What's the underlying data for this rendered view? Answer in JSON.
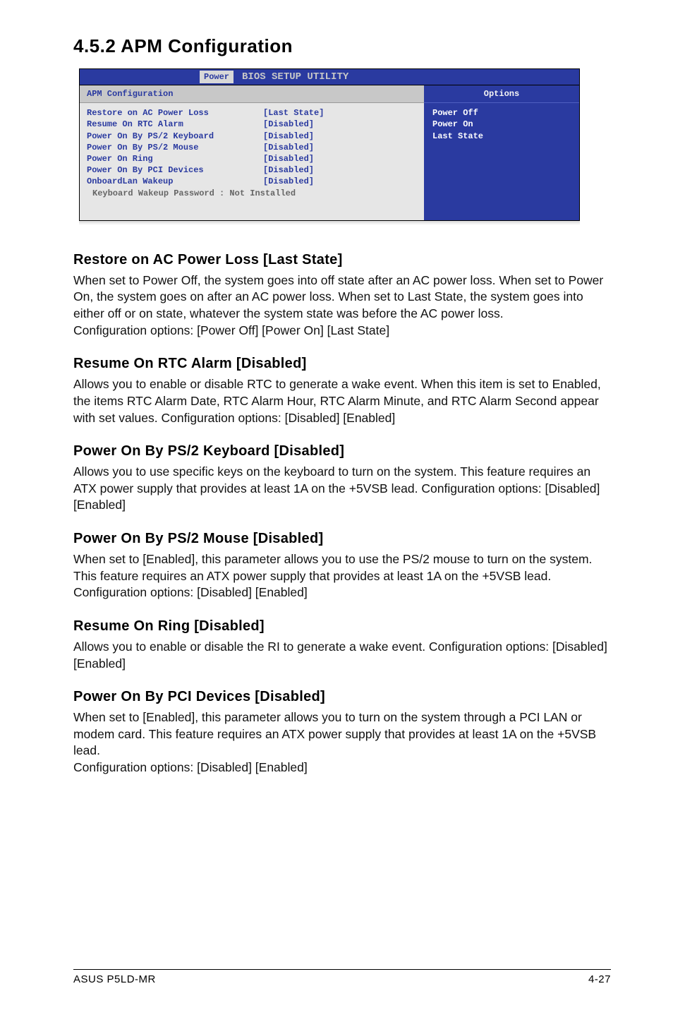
{
  "heading": "4.5.2   APM Configuration",
  "bios": {
    "util_title": "BIOS SETUP UTILITY",
    "tab": "Power",
    "section_head": "APM Configuration",
    "items": [
      {
        "label": "Restore on AC Power Loss",
        "value": "[Last State]"
      },
      {
        "label": "Resume On RTC Alarm",
        "value": "[Disabled]"
      },
      {
        "label": "Power On By PS/2 Keyboard",
        "value": "[Disabled]"
      },
      {
        "label": "Power On By PS/2 Mouse",
        "value": "[Disabled]"
      },
      {
        "label": "Power On Ring",
        "value": "[Disabled]"
      },
      {
        "label": "Power On By PCI Devices",
        "value": "[Disabled]"
      },
      {
        "label": "OnboardLan Wakeup",
        "value": "[Disabled]"
      }
    ],
    "subline": "Keyboard Wakeup Password : Not Installed",
    "options_head": "Options",
    "options": [
      "Power Off",
      "Power On",
      "Last State"
    ]
  },
  "sections": [
    {
      "title": "Restore on AC Power Loss [Last State]",
      "body": "When set to Power Off, the system goes into off state after an AC power loss. When set to Power On, the system goes on after an AC power loss. When set to Last State, the system goes into either off or on state, whatever the system state was before the AC power loss.\nConfiguration options: [Power Off] [Power On] [Last State]"
    },
    {
      "title": "Resume On RTC Alarm [Disabled]",
      "body": "Allows you to enable or disable RTC to generate a wake event. When this item is set to Enabled, the items RTC Alarm Date, RTC Alarm Hour, RTC Alarm Minute, and RTC Alarm Second appear with set values. Configuration options: [Disabled] [Enabled]"
    },
    {
      "title": "Power On By PS/2 Keyboard [Disabled]",
      "body": "Allows you to use specific keys on the keyboard to turn on the system. This feature requires an ATX power supply that provides at least 1A on the +5VSB lead. Configuration options: [Disabled] [Enabled]"
    },
    {
      "title": "Power On By PS/2 Mouse [Disabled]",
      "body": "When set to [Enabled], this parameter allows you to use the PS/2 mouse to turn on the system. This feature requires an ATX power supply that provides at least 1A on the +5VSB lead.\nConfiguration options: [Disabled] [Enabled]"
    },
    {
      "title": "Resume On Ring [Disabled]",
      "body": "Allows you to enable or disable the RI to generate a wake event. Configuration options: [Disabled] [Enabled]"
    },
    {
      "title": "Power On By PCI Devices [Disabled]",
      "body": "When set to [Enabled], this parameter allows you to turn on the system through a PCI LAN or modem card. This feature requires an ATX power supply that provides at least 1A on the +5VSB lead.\nConfiguration options: [Disabled] [Enabled]"
    }
  ],
  "footer": {
    "left": "ASUS P5LD-MR",
    "right": "4-27"
  }
}
